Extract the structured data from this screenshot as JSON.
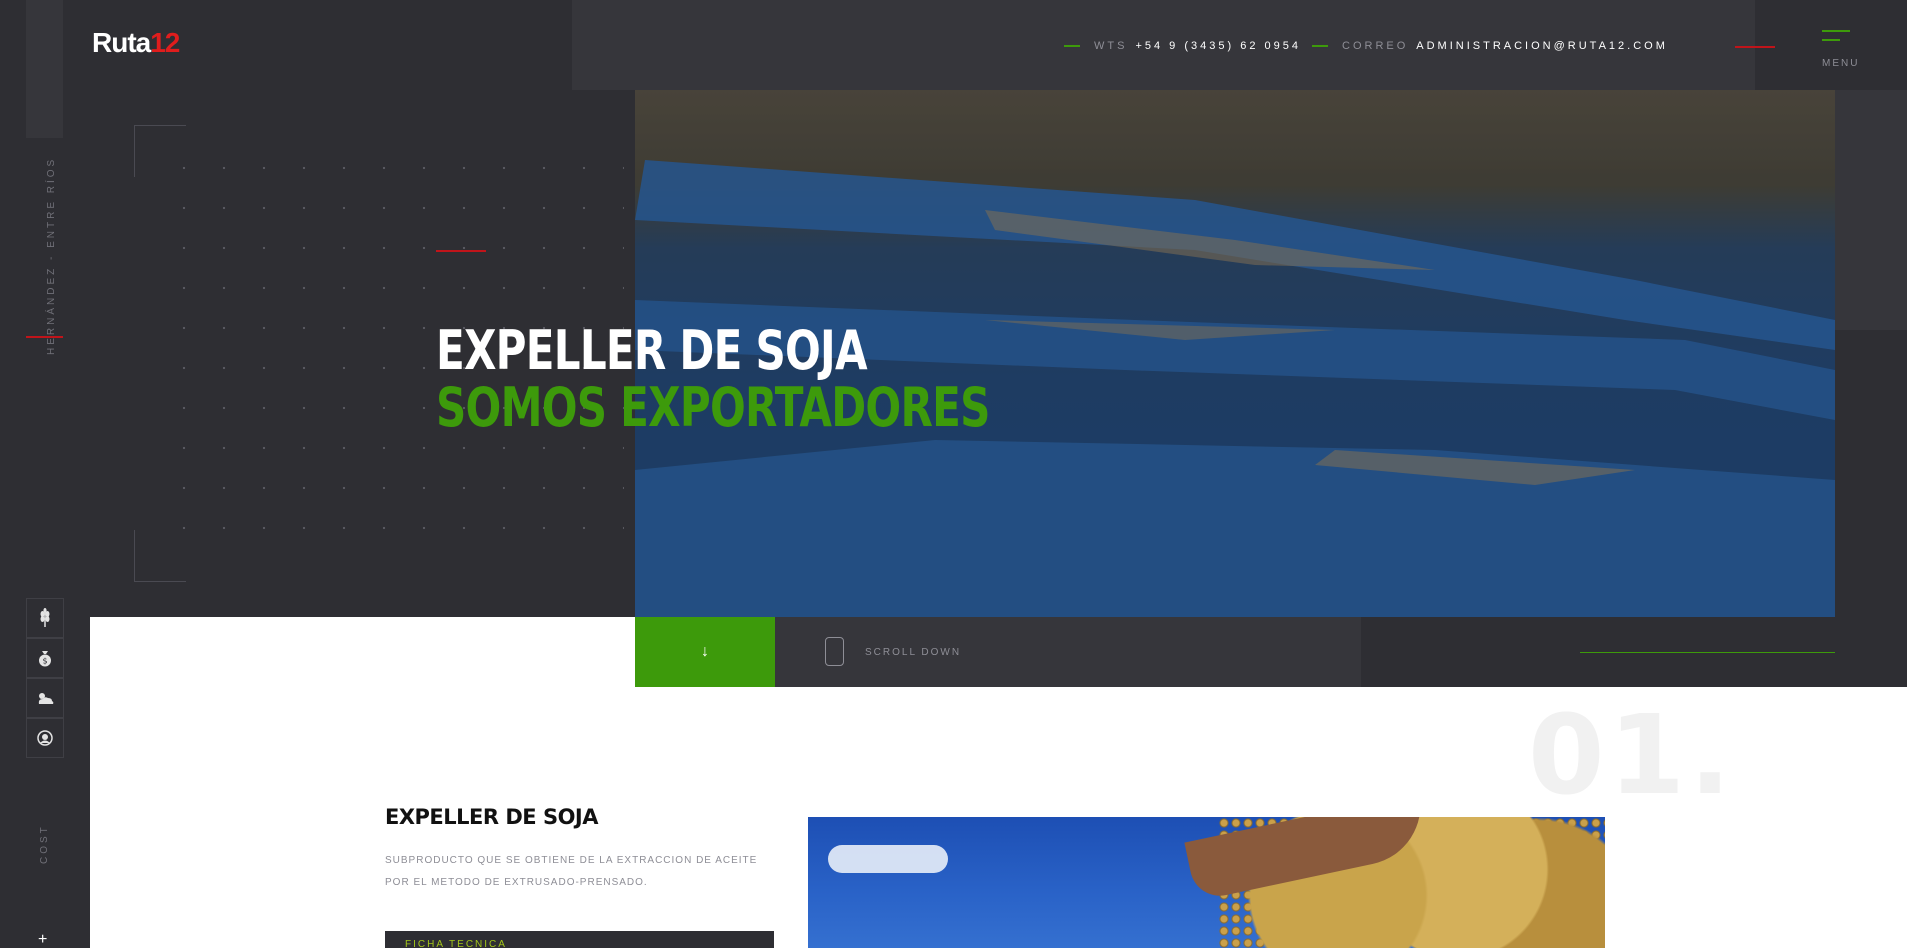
{
  "logo": {
    "text": "Ruta",
    "num": "12"
  },
  "header": {
    "wts_label": "WTS",
    "wts_value": "+54 9 (3435) 62 0954",
    "mail_label": "CORREO",
    "mail_value": "ADMINISTRACION@RUTA12.COM",
    "menu_label": "MENU"
  },
  "rail": {
    "location": "HERNÁNDEZ - ENTRE RÍOS",
    "icons": [
      "wheat-icon",
      "money-bag-icon",
      "weather-icon",
      "user-icon"
    ],
    "cost_label": "COST",
    "plus": "+"
  },
  "hero": {
    "title_line1": "EXPELLER DE SOJA",
    "title_line2": "SOMOS EXPORTADORES",
    "accent_green": "#3d9a0b",
    "accent_red": "#c0141a"
  },
  "scroll": {
    "arrow": "↓",
    "label": "SCROLL DOWN"
  },
  "section": {
    "number": "01.",
    "title": "EXPELLER DE SOJA",
    "description": "SUBPRODUCTO QUE SE OBTIENE DE LA EXTRACCION DE ACEITE POR EL METODO DE EXTRUSADO-PRENSADO.",
    "button_label": "FICHA TECNICA"
  }
}
